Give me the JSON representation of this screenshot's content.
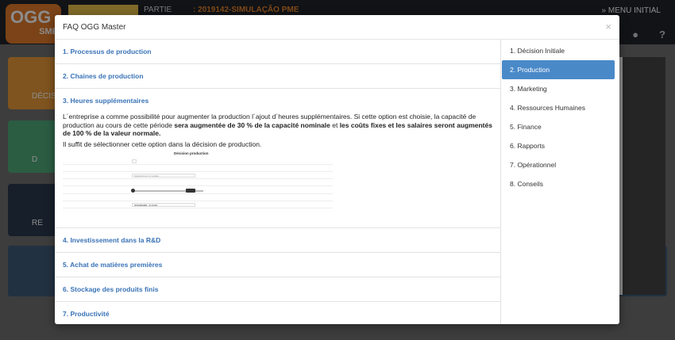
{
  "background": {
    "logo_text": "OGG",
    "logo_sub": "SME",
    "partie_label": "PARTIE",
    "game_name": ": 2019142-SIMULAÇÃO PME",
    "menu_label": "» MENU INITIAL",
    "tile_labels": [
      "DÉCIS",
      "D",
      "RE"
    ]
  },
  "modal": {
    "title": "FAQ OGG Master",
    "close": "×"
  },
  "sections": [
    {
      "title": "1. Processus de production"
    },
    {
      "title": "2. Chaines de production"
    },
    {
      "title": "3. Heures supplémentaires"
    },
    {
      "title": "4. Investissement dans la R&D"
    },
    {
      "title": "5. Achat de matières premières"
    },
    {
      "title": "6. Stockage des produits finis"
    },
    {
      "title": "7. Productivité"
    }
  ],
  "heures": {
    "p1_a": "L´entreprise a comme possibilité pour augmenter la production l´ajout d´heures supplémentaires. Si cette option est choisie, la capacité de production au cours de cette période ",
    "p1_b": "sera augmentée de 30 % de la capacité nominale",
    "p1_c": " et ",
    "p1_d": "les coûts fixes et les salaires seront augmentés de 100 % de la valeur normale.",
    "p2": "Il suffit de sélectionner cette option dans la décision de production.",
    "mini_title": "Décision production",
    "mini_select": "Sélectionnez le modèle",
    "mini_select2": "STANDARD - $ 14.00"
  },
  "nav": [
    {
      "label": "1. Décision Initiale",
      "active": false
    },
    {
      "label": "2. Production",
      "active": true
    },
    {
      "label": "3. Marketing",
      "active": false
    },
    {
      "label": "4. Ressources Humaines",
      "active": false
    },
    {
      "label": "5. Finance",
      "active": false
    },
    {
      "label": "6. Rapports",
      "active": false
    },
    {
      "label": "7. Opérationnel",
      "active": false
    },
    {
      "label": "8. Conseils",
      "active": false
    }
  ]
}
